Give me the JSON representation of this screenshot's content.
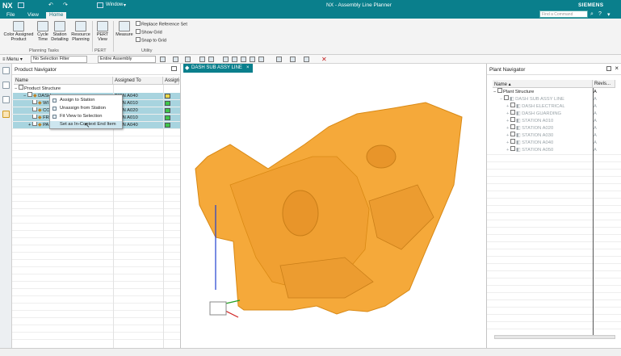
{
  "app": {
    "logo": "NX",
    "window_menu": "Window",
    "title": "NX - Assembly Line Planner",
    "brand": "SIEMENS",
    "search_placeholder": "Find a Command"
  },
  "tabs": [
    {
      "label": "File"
    },
    {
      "label": "View"
    },
    {
      "label": "Home"
    }
  ],
  "ribbon": {
    "buttons": [
      {
        "label": "Color Assigned Product"
      },
      {
        "label": "Cycle Time"
      },
      {
        "label": "Station Detailing"
      },
      {
        "label": "Resource Planning"
      },
      {
        "label": "PERT View"
      },
      {
        "label": "Measure"
      }
    ],
    "utility_items": [
      "Replace Reference Set",
      "Show Grid",
      "Snap to Grid"
    ],
    "groups": [
      "Planning Tasks",
      "PERT",
      "Utility"
    ]
  },
  "toolbar": {
    "menu": "Menu",
    "filter": "No Selection Filter",
    "scope": "Entire Assembly"
  },
  "product_navigator": {
    "title": "Product Navigator",
    "columns": [
      "Name",
      "Assigned To",
      "Assign"
    ],
    "root": "Product Structure",
    "rows": [
      {
        "name": "DASH",
        "assigned": "TION A040",
        "status": "#e8d84a",
        "selected": true
      },
      {
        "name": "WI",
        "assigned": "TION A010",
        "status": "#3cc84a",
        "selected": true
      },
      {
        "name": "CO",
        "assigned": "TION A020",
        "status": "#3cc84a",
        "selected": true
      },
      {
        "name": "FR",
        "assigned": "TION A010",
        "status": "#3cc84a",
        "selected": true
      },
      {
        "name": "PA",
        "assigned": "TION A040",
        "status": "#3cc84a",
        "selected": true
      }
    ]
  },
  "context_menu": {
    "items": [
      "Assign to Station",
      "Unassign from Station",
      "Fit View to Selection",
      "Set as In-Context End Item"
    ]
  },
  "graphics": {
    "tab": "DASH SUB ASSY LINE"
  },
  "plant_navigator": {
    "title": "Plant Navigator",
    "columns": [
      "Name",
      "Revis..."
    ],
    "root": "Plant Structure",
    "rows": [
      {
        "name": "DASH SUB ASSY LINE",
        "rev": "A"
      },
      {
        "name": "DASH ELECTRICAL",
        "rev": "A"
      },
      {
        "name": "DASH GUARDING",
        "rev": "A"
      },
      {
        "name": "STATION A010",
        "rev": "A"
      },
      {
        "name": "STATION A020",
        "rev": "A"
      },
      {
        "name": "STATION A030",
        "rev": "A"
      },
      {
        "name": "STATION A040",
        "rev": "A"
      },
      {
        "name": "STATION A050",
        "rev": "A"
      }
    ],
    "root_rev": "A"
  },
  "colors": {
    "accent": "#0a7f8c",
    "part": "#f5a93a",
    "selection": "#a8d4df"
  }
}
